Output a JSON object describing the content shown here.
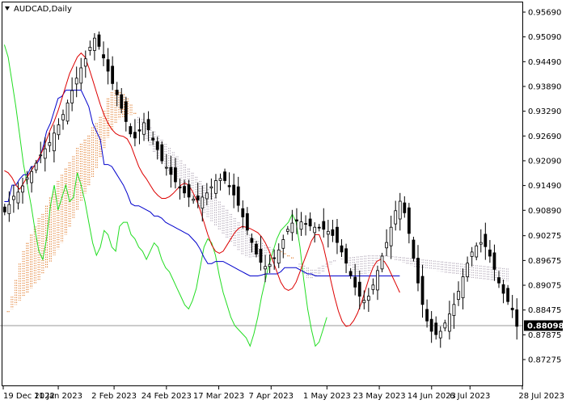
{
  "window": {
    "title": "AUDCAD,Daily",
    "symbol_menu_icon": "triangle-down-icon"
  },
  "price_tag": {
    "label": "0.88098"
  },
  "colors": {
    "background": "#ffffff",
    "candle": "#000000",
    "tenkan": "#dd0000",
    "kijun": "#0000cc",
    "chikou": "#22dd22",
    "cloud_up": "#e07a2a",
    "cloud_down": "#b0a6b6",
    "current_price_line": "#9a9a9a",
    "price_tag_bg": "#000000"
  },
  "chart_data": {
    "type": "candlestick",
    "title": "AUDCAD,Daily",
    "indicator": "Ichimoku Kinko Hyo",
    "ylim": [
      0.87275,
      0.9569
    ],
    "y_ticks": [
      "0.95690",
      "0.95090",
      "0.94490",
      "0.93890",
      "0.93290",
      "0.92690",
      "0.92090",
      "0.91490",
      "0.90890",
      "0.90275",
      "0.89675",
      "0.89075",
      "0.88475",
      "0.87875",
      "0.87275"
    ],
    "x_ticks": [
      "19 Dec 2022",
      "11 Jan 2023",
      "2 Feb 2023",
      "24 Feb 2023",
      "17 Mar 2023",
      "7 Apr 2023",
      "1 May 2023",
      "23 May 2023",
      "14 Jun 2023",
      "6 Jul 2023",
      "28 Jul 2023"
    ],
    "current_price": 0.88098,
    "close": [
      0.9085,
      0.9103,
      0.9123,
      0.9133,
      0.9148,
      0.9168,
      0.9183,
      0.9203,
      0.9223,
      0.9238,
      0.9253,
      0.9276,
      0.9296,
      0.9321,
      0.9349,
      0.9379,
      0.9409,
      0.9434,
      0.9456,
      0.9484,
      0.9506,
      0.9486,
      0.9458,
      0.9426,
      0.9396,
      0.9369,
      0.9336,
      0.9304,
      0.9274,
      0.9264,
      0.9281,
      0.9301,
      0.9284,
      0.9259,
      0.9236,
      0.9209,
      0.9193,
      0.9176,
      0.9158,
      0.9143,
      0.9131,
      0.9121,
      0.9116,
      0.9114,
      0.9121,
      0.9131,
      0.9146,
      0.9161,
      0.9166,
      0.9161,
      0.9146,
      0.9126,
      0.9101,
      0.9073,
      0.9041,
      0.9011,
      0.8983,
      0.8963,
      0.8953,
      0.8958,
      0.8973,
      0.8993,
      0.9018,
      0.9043,
      0.9058,
      0.9063,
      0.9061,
      0.9056,
      0.9051,
      0.9048,
      0.9046,
      0.9043,
      0.9038,
      0.9028,
      0.9011,
      0.8988,
      0.8961,
      0.8931,
      0.8903,
      0.8881,
      0.8871,
      0.8881,
      0.8908,
      0.8943,
      0.8978,
      0.9011,
      0.9048,
      0.9088,
      0.9111,
      0.9083,
      0.9033,
      0.8973,
      0.8913,
      0.8861,
      0.8821,
      0.8796,
      0.8788,
      0.8796,
      0.8816,
      0.8838,
      0.8861,
      0.8893,
      0.8928,
      0.8961,
      0.8988,
      0.9003,
      0.9011,
      0.9001,
      0.8978,
      0.8946,
      0.8913,
      0.8888,
      0.8868,
      0.8848,
      0.8808
    ],
    "series": [
      {
        "name": "Tenkan-sen",
        "values": [
          0.9185,
          0.918,
          0.9168,
          0.915,
          0.914,
          0.9155,
          0.917,
          0.9185,
          0.92,
          0.9215,
          0.9235,
          0.926,
          0.9285,
          0.9305,
          0.933,
          0.936,
          0.939,
          0.942,
          0.944,
          0.946,
          0.947,
          0.946,
          0.9435,
          0.9405,
          0.9375,
          0.9345,
          0.932,
          0.93,
          0.9285,
          0.9275,
          0.927,
          0.9268,
          0.9262,
          0.9245,
          0.922,
          0.9195,
          0.9178,
          0.9165,
          0.915,
          0.9135,
          0.9125,
          0.9118,
          0.9118,
          0.9122,
          0.913,
          0.914,
          0.915,
          0.9155,
          0.915,
          0.9135,
          0.9115,
          0.909,
          0.906,
          0.903,
          0.9005,
          0.899,
          0.8985,
          0.899,
          0.9005,
          0.902,
          0.9035,
          0.9045,
          0.905,
          0.9048,
          0.9045,
          0.904,
          0.9035,
          0.9025,
          0.901,
          0.899,
          0.8965,
          0.894,
          0.8915,
          0.89,
          0.8895,
          0.89,
          0.8915,
          0.894,
          0.8965,
          0.899,
          0.9015,
          0.903,
          0.903,
          0.9005,
          0.8965,
          0.892,
          0.888,
          0.8845,
          0.882,
          0.8808,
          0.881,
          0.8822,
          0.884,
          0.8865,
          0.8895,
          0.8925,
          0.895,
          0.8965,
          0.897,
          0.8965,
          0.895,
          0.893,
          0.891,
          0.889
        ]
      },
      {
        "name": "Kijun-sen",
        "values": [
          0.911,
          0.911,
          0.915,
          0.915,
          0.9165,
          0.9175,
          0.9175,
          0.9195,
          0.9195,
          0.921,
          0.924,
          0.928,
          0.93,
          0.933,
          0.936,
          0.9365,
          0.938,
          0.938,
          0.938,
          0.938,
          0.938,
          0.936,
          0.934,
          0.93,
          0.928,
          0.926,
          0.92,
          0.92,
          0.9195,
          0.918,
          0.9165,
          0.915,
          0.913,
          0.9105,
          0.91,
          0.91,
          0.9095,
          0.909,
          0.9085,
          0.9075,
          0.9075,
          0.907,
          0.906,
          0.9055,
          0.905,
          0.9045,
          0.904,
          0.9035,
          0.903,
          0.902,
          0.901,
          0.8995,
          0.8975,
          0.896,
          0.896,
          0.8965,
          0.8965,
          0.8965,
          0.896,
          0.8955,
          0.895,
          0.8945,
          0.894,
          0.8935,
          0.893,
          0.893,
          0.893,
          0.8932,
          0.8935,
          0.8935,
          0.8935,
          0.8935,
          0.894,
          0.895,
          0.895,
          0.895,
          0.895,
          0.8945,
          0.894,
          0.8935,
          0.8935,
          0.893,
          0.893,
          0.893,
          0.893,
          0.893,
          0.893,
          0.893,
          0.893,
          0.893,
          0.893,
          0.893,
          0.893,
          0.893,
          0.893,
          0.893,
          0.893,
          0.893,
          0.893,
          0.893,
          0.893,
          0.893,
          0.893,
          0.893
        ]
      },
      {
        "name": "Chikou Span",
        "values": [
          0.949,
          0.946,
          0.94,
          0.934,
          0.927,
          0.92,
          0.915,
          0.91,
          0.904,
          0.899,
          0.897,
          0.902,
          0.91,
          0.915,
          0.909,
          0.912,
          0.915,
          0.911,
          0.912,
          0.918,
          0.915,
          0.911,
          0.906,
          0.901,
          0.898,
          0.9,
          0.904,
          0.903,
          0.9,
          0.899,
          0.905,
          0.906,
          0.906,
          0.903,
          0.902,
          0.9,
          0.899,
          0.897,
          0.899,
          0.901,
          0.9,
          0.897,
          0.895,
          0.894,
          0.892,
          0.89,
          0.888,
          0.886,
          0.885,
          0.887,
          0.89,
          0.895,
          0.9,
          0.902,
          0.901,
          0.898,
          0.893,
          0.889,
          0.886,
          0.883,
          0.881,
          0.88,
          0.879,
          0.878,
          0.876,
          0.879,
          0.883,
          0.888,
          0.892,
          0.896,
          0.899,
          0.902,
          0.904,
          0.905,
          0.906,
          0.908,
          0.906,
          0.9,
          0.892,
          0.885,
          0.88,
          0.876,
          0.877,
          0.88,
          0.883
        ]
      },
      {
        "name": "Senkou Span A",
        "values": [
          0.883,
          0.8845,
          0.888,
          0.892,
          0.896,
          0.899,
          0.901,
          0.903,
          0.905,
          0.907,
          0.908,
          0.91,
          0.912,
          0.914,
          0.916,
          0.9175,
          0.919,
          0.9205,
          0.922,
          0.924,
          0.925,
          0.926,
          0.927,
          0.929,
          0.93,
          0.9315,
          0.933,
          0.936,
          0.9375,
          0.938,
          0.9375,
          0.937,
          0.936,
          0.9345,
          0.9325,
          0.93,
          0.928,
          0.926,
          0.9245,
          0.923,
          0.9215,
          0.9205,
          0.9195,
          0.9185,
          0.9175,
          0.9165,
          0.9155,
          0.9145,
          0.914,
          0.9125,
          0.911,
          0.9095,
          0.908,
          0.907,
          0.906,
          0.905,
          0.904,
          0.903,
          0.902,
          0.901,
          0.9,
          0.899,
          0.898,
          0.8975,
          0.8975,
          0.8975,
          0.8975,
          0.8978,
          0.898,
          0.8985,
          0.8988,
          0.899,
          0.899,
          0.8985,
          0.898,
          0.8975,
          0.8965,
          0.895,
          0.8935,
          0.8925,
          0.8925,
          0.8928,
          0.8932,
          0.894,
          0.895,
          0.8958,
          0.8965,
          0.897,
          0.897,
          0.8965,
          0.8955,
          0.8945,
          0.8935,
          0.893,
          0.8932,
          0.8938,
          0.895,
          0.896,
          0.897,
          0.8975,
          0.8975,
          0.8972,
          0.8968,
          0.8965,
          0.8962,
          0.8958,
          0.8955,
          0.8952,
          0.895,
          0.8948,
          0.8946,
          0.8945,
          0.8944,
          0.8942,
          0.894,
          0.8938,
          0.8936,
          0.8934,
          0.8932,
          0.893,
          0.8928,
          0.8926,
          0.8925,
          0.8924,
          0.8923,
          0.8922,
          0.8921,
          0.892,
          0.892,
          0.8919,
          0.8918,
          0.8917
        ]
      },
      {
        "name": "Senkou Span B",
        "values": [
          0.883,
          0.884,
          0.885,
          0.886,
          0.887,
          0.888,
          0.889,
          0.89,
          0.891,
          0.892,
          0.8935,
          0.895,
          0.8965,
          0.898,
          0.8995,
          0.901,
          0.903,
          0.905,
          0.907,
          0.909,
          0.911,
          0.913,
          0.915,
          0.917,
          0.919,
          0.9215,
          0.924,
          0.9265,
          0.9285,
          0.93,
          0.931,
          0.9315,
          0.932,
          0.932,
          0.932,
          0.9315,
          0.931,
          0.93,
          0.929,
          0.928,
          0.927,
          0.926,
          0.925,
          0.924,
          0.923,
          0.922,
          0.921,
          0.92,
          0.919,
          0.918,
          0.917,
          0.916,
          0.915,
          0.914,
          0.913,
          0.912,
          0.911,
          0.91,
          0.909,
          0.908,
          0.907,
          0.906,
          0.905,
          0.904,
          0.903,
          0.902,
          0.9015,
          0.901,
          0.9005,
          0.9,
          0.8995,
          0.899,
          0.8985,
          0.898,
          0.8975,
          0.897,
          0.8965,
          0.896,
          0.8955,
          0.895,
          0.8945,
          0.8945,
          0.895,
          0.8955,
          0.896,
          0.8965,
          0.8968,
          0.897,
          0.8972,
          0.8974,
          0.8975,
          0.8976,
          0.8977,
          0.8978,
          0.8979,
          0.898,
          0.898,
          0.898,
          0.898,
          0.898,
          0.8979,
          0.8978,
          0.8977,
          0.8976,
          0.8975,
          0.8974,
          0.8973,
          0.8972,
          0.8971,
          0.897,
          0.8969,
          0.8968,
          0.8967,
          0.8966,
          0.8965,
          0.8964,
          0.8963,
          0.8962,
          0.8961,
          0.896,
          0.8959,
          0.8958,
          0.8957,
          0.8956,
          0.8955,
          0.8954,
          0.8953,
          0.8952,
          0.8951,
          0.895,
          0.8949,
          0.8948,
          0.8947
        ]
      }
    ]
  }
}
